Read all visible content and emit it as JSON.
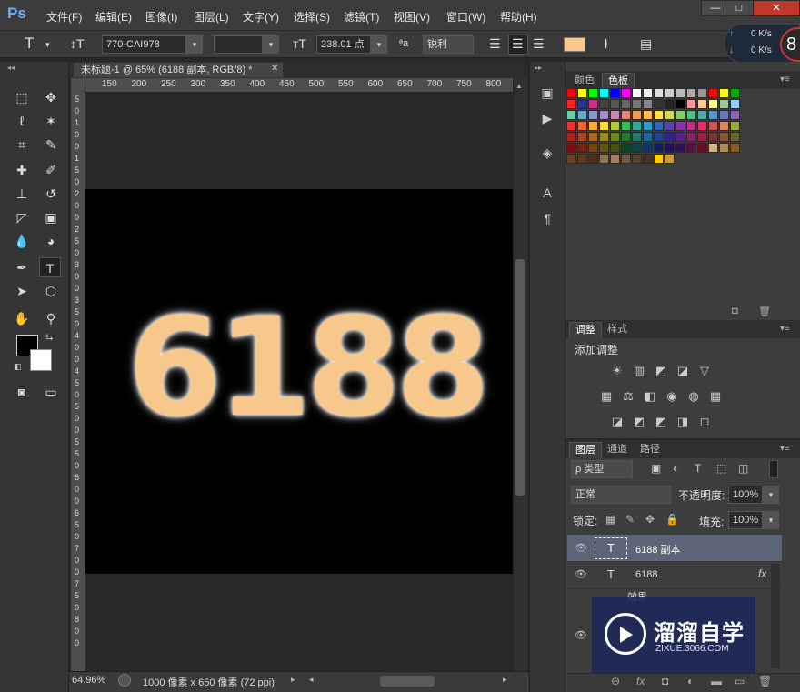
{
  "app": {
    "logo": "Ps",
    "menu": [
      "文件(F)",
      "编辑(E)",
      "图像(I)",
      "图层(L)",
      "文字(Y)",
      "选择(S)",
      "滤镜(T)",
      "视图(V)",
      "窗口(W)",
      "帮助(H)"
    ],
    "window_buttons": [
      "—",
      "□",
      "✕"
    ]
  },
  "options": {
    "font_family": "770-CAI978",
    "font_style": "",
    "font_size": "238.01 点",
    "aa_prefix": "ªa",
    "antialias": "锐利",
    "color_swatch": "#f7c78c"
  },
  "network": {
    "up": "0 K/s",
    "down": "0 K/s",
    "badge": "8"
  },
  "document": {
    "tab_title": "未标题-1 @ 65% (6188 副本, RGB/8) *",
    "content_text": "6188",
    "zoom": "64.96%",
    "doc_size": "1000 像素 x 650 像素 (72 ppi)"
  },
  "ruler": {
    "h_labels": [
      "150",
      "200",
      "250",
      "300",
      "350",
      "400",
      "450",
      "500",
      "550",
      "600",
      "650",
      "700",
      "750",
      "800"
    ],
    "v_digits": [
      "5",
      "0",
      "1",
      "0",
      "0",
      "1",
      "5",
      "0",
      "2",
      "0",
      "0",
      "2",
      "5",
      "0",
      "3",
      "0",
      "0",
      "3",
      "5",
      "0",
      "4",
      "0",
      "0",
      "4",
      "5",
      "0",
      "5",
      "0",
      "0",
      "5",
      "5",
      "0",
      "6",
      "0",
      "0",
      "6",
      "5",
      "0",
      "7",
      "0",
      "0",
      "7",
      "5",
      "0",
      "8",
      "0",
      "0"
    ]
  },
  "swatches_panel": {
    "tabs": [
      "颜色",
      "色板"
    ],
    "colors": [
      "#ff0000",
      "#ffff00",
      "#00ff00",
      "#00ffff",
      "#0000ff",
      "#ff00ff",
      "#ffffff",
      "#eeeeee",
      "#dddddd",
      "#cccccc",
      "#bbbbbb",
      "#aaaaaa",
      "#999999",
      "#ff0000",
      "#ffff00",
      "#00aa00",
      "#ff2222",
      "#223399",
      "#cc3388",
      "#444444",
      "#555555",
      "#666666",
      "#777777",
      "#888888",
      "#333333",
      "#222222",
      "#000000",
      "#ff9999",
      "#ffcc99",
      "#ffff99",
      "#99cc99",
      "#99ccff",
      "#66ccaa",
      "#66aacc",
      "#8899cc",
      "#aa88cc",
      "#cc88aa",
      "#dd8877",
      "#ee9955",
      "#ffbb55",
      "#ffdd55",
      "#ccdd55",
      "#88cc66",
      "#55bb88",
      "#55aaaa",
      "#5599cc",
      "#6677bb",
      "#8866aa",
      "#ee3333",
      "#ee6633",
      "#ffaa33",
      "#ffdd33",
      "#aacc33",
      "#33bb55",
      "#33aa99",
      "#3399cc",
      "#3366bb",
      "#5544aa",
      "#8833aa",
      "#bb3388",
      "#dd3366",
      "#cc5555",
      "#dd8855",
      "#99aa44",
      "#aa2222",
      "#aa4422",
      "#aa6622",
      "#998822",
      "#668822",
      "#227733",
      "#227766",
      "#226699",
      "#224488",
      "#332288",
      "#552288",
      "#882266",
      "#992244",
      "#773333",
      "#885533",
      "#666633",
      "#771111",
      "#772211",
      "#774411",
      "#665511",
      "#445511",
      "#114422",
      "#114444",
      "#113366",
      "#112255",
      "#221155",
      "#331155",
      "#551144",
      "#661122",
      "#d2b48c",
      "#b08a5a",
      "#8b5a2b",
      "#6b4226",
      "#5a3a22",
      "#4a2f1c",
      "#8b7355",
      "#a08060",
      "#6b5a45",
      "#554433",
      "#443322",
      "#ffcc00",
      "#cc9933"
    ]
  },
  "adjustments_panel": {
    "tabs": [
      "调整",
      "样式"
    ],
    "heading": "添加调整",
    "row1": [
      "☀",
      "▥",
      "◩",
      "◪",
      "▽"
    ],
    "row2": [
      "▦",
      "⚖",
      "◧",
      "◉",
      "◍",
      "▦"
    ],
    "row3": [
      "◪",
      "◩",
      "◩",
      "◨",
      "◻"
    ]
  },
  "layers_panel": {
    "tabs": [
      "图层",
      "通道",
      "路径"
    ],
    "filter_label": "ρ 类型",
    "blend_mode": "正常",
    "opacity_label": "不透明度:",
    "opacity": "100%",
    "lock_label": "锁定:",
    "fill_label": "填充:",
    "fill": "100%",
    "layers": [
      {
        "name": "6188 副本",
        "type": "T"
      },
      {
        "name": "6188",
        "type": "T",
        "fx": "fx"
      }
    ],
    "effects_label": "效果",
    "bottom_icons": [
      "⊖",
      "fx",
      "◘",
      "◐",
      "▬",
      "▭",
      "🗑"
    ]
  },
  "watermark": {
    "title": "溜溜自学",
    "url": "ZIXUE.3066.COM"
  },
  "dock": [
    "▣",
    "▶",
    "◈",
    "A",
    "¶"
  ]
}
